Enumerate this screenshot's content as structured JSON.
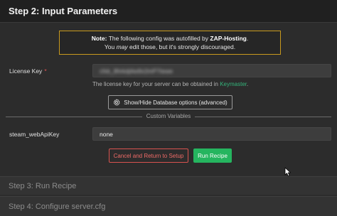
{
  "step2": {
    "title": "Step 2: Input Parameters"
  },
  "notice": {
    "bold_prefix": "Note:",
    "text_part1": " The following config was autofilled by ",
    "brand": "ZAP-Hosting",
    "text_part2": ".",
    "line2_part1": "You ",
    "line2_em": "may",
    "line2_part2": " edit those, but it's strongly discouraged."
  },
  "license_key": {
    "label": "License Key",
    "required_mark": "*",
    "value": "cfxk_8hrkdj4w9x2mP7tewe",
    "help_text": "The license key for your server can be obtained in ",
    "help_link": "Keymaster",
    "help_suffix": "."
  },
  "db_toggle": {
    "icon": "gear-icon",
    "label": "Show/Hide Database options (advanced)"
  },
  "custom_variables": {
    "heading": "Custom Variables"
  },
  "steam_api_key": {
    "label": "steam_webApiKey",
    "value": "none"
  },
  "actions": {
    "cancel_label": "Cancel and Return to Setup",
    "run_label": "Run Recipe"
  },
  "step3": {
    "title": "Step 3: Run Recipe"
  },
  "step4": {
    "title": "Step 4: Configure server.cfg"
  },
  "colors": {
    "notice_border": "#c99a1e",
    "link": "#34b37a",
    "cancel": "#d9534f",
    "run": "#25b55f",
    "required": "#e05555"
  }
}
